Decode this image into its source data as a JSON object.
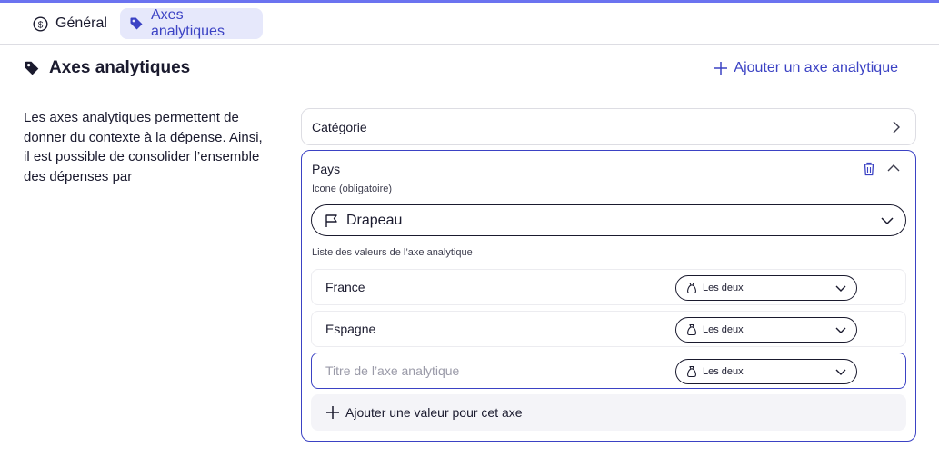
{
  "tabs": [
    {
      "label": "Général",
      "icon": "dollar-circle-icon"
    },
    {
      "label": "Axes analytiques",
      "icon": "tag-icon",
      "active": true
    }
  ],
  "section": {
    "title": "Axes analytiques",
    "add_axis_label": "Ajouter un axe analytique",
    "description": "Les axes analytiques permettent de donner du contexte à la dépense. Ainsi, il est possible de consolider l’ensemble des dépenses par"
  },
  "axes": [
    {
      "name": "Catégorie",
      "expanded": false
    },
    {
      "name": "Pays",
      "expanded": true,
      "icon_field_label": "Icone (obligatoire)",
      "icon_value": "Drapeau",
      "values_label": "Liste des valeurs de l’axe analytique",
      "values": [
        {
          "name": "France",
          "type": "Les deux"
        },
        {
          "name": "Espagne",
          "type": "Les deux"
        }
      ],
      "new_value": {
        "placeholder": "Titre de l’axe analytique",
        "type": "Les deux"
      },
      "add_value_label": "Ajouter une valeur pour cet axe"
    }
  ],
  "colors": {
    "accent": "#3b42c4",
    "active_tab_bg": "#e6e8fb",
    "top_line": "#6b73f0"
  }
}
